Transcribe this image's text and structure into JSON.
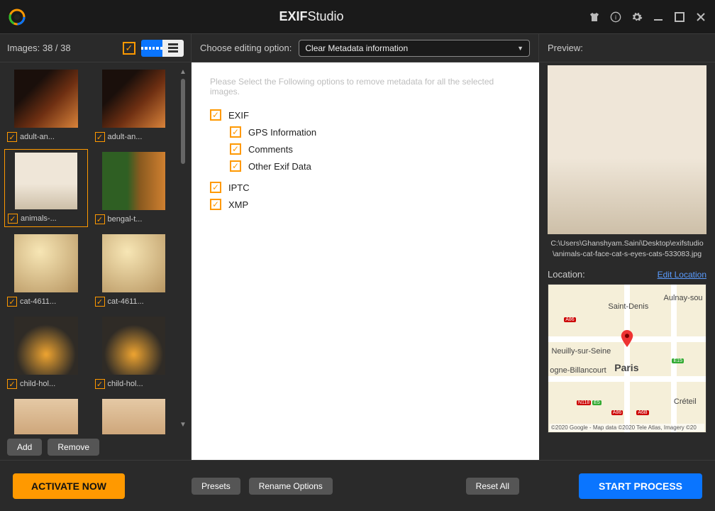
{
  "title_bold": "EXIF",
  "title_reg": "Studio",
  "images_label": "Images: 38 / 38",
  "editing_option_label": "Choose editing option:",
  "dropdown_selected": "Clear Metadata information",
  "preview_label": "Preview:",
  "center_hint": "Please Select the Following options to remove metadata for all the selected images.",
  "opts": {
    "exif": "EXIF",
    "gps": "GPS Information",
    "comments": "Comments",
    "other": "Other Exif Data",
    "iptc": "IPTC",
    "xmp": "XMP"
  },
  "thumbs": [
    {
      "name": "adult-an..."
    },
    {
      "name": "adult-an..."
    },
    {
      "name": "animals-..."
    },
    {
      "name": "bengal-t..."
    },
    {
      "name": "cat-4611..."
    },
    {
      "name": "cat-4611..."
    },
    {
      "name": "child-hol..."
    },
    {
      "name": "child-hol..."
    },
    {
      "name": ""
    },
    {
      "name": ""
    }
  ],
  "sidebar_buttons": {
    "add": "Add",
    "remove": "Remove"
  },
  "preview_path": "C:\\Users\\Ghanshyam.Saini\\Desktop\\exifstudio\\animals-cat-face-cat-s-eyes-cats-533083.jpg",
  "location_label": "Location:",
  "edit_location": "Edit Location",
  "map": {
    "center": "Paris",
    "nw": "Saint-Denis",
    "ne": "Aulnay-sou",
    "w": "Neuilly-sur-Seine",
    "sw": "ogne-Billancourt",
    "se": "Créteil",
    "attrib": "©2020 Google - Map data ©2020 Tele Atlas, Imagery ©20"
  },
  "bottom": {
    "activate": "ACTIVATE NOW",
    "presets": "Presets",
    "rename": "Rename Options",
    "reset": "Reset All",
    "start": "START PROCESS"
  }
}
